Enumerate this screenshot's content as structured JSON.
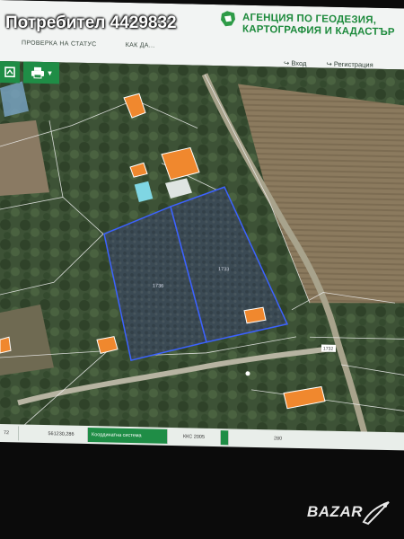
{
  "watermark_user": "Потребител 4429832",
  "header": {
    "agency_name_line1": "АГЕНЦИЯ ПО ГЕОДЕЗИЯ,",
    "agency_name_line2": "КАРТОГРАФИЯ И КАДАСТЪР",
    "nav": [
      "ПРОВЕРКА НА СТАТУС",
      "КАК ДА..."
    ],
    "login": "Вход",
    "register": "Регистрация"
  },
  "toolbar": {
    "layers_icon": "layers-icon",
    "print_icon": "print-icon"
  },
  "map": {
    "parcel_labels": [
      "1736",
      "1733"
    ],
    "road_label": "1732",
    "building_color": "#f0882e",
    "parcel_outline_color": "#3c62ff"
  },
  "statusbar": {
    "cells": [
      "72",
      "561230,286",
      "Координатна система",
      "ККС 2005"
    ],
    "right_label": "280"
  },
  "bazar_logo": "BAZAR"
}
